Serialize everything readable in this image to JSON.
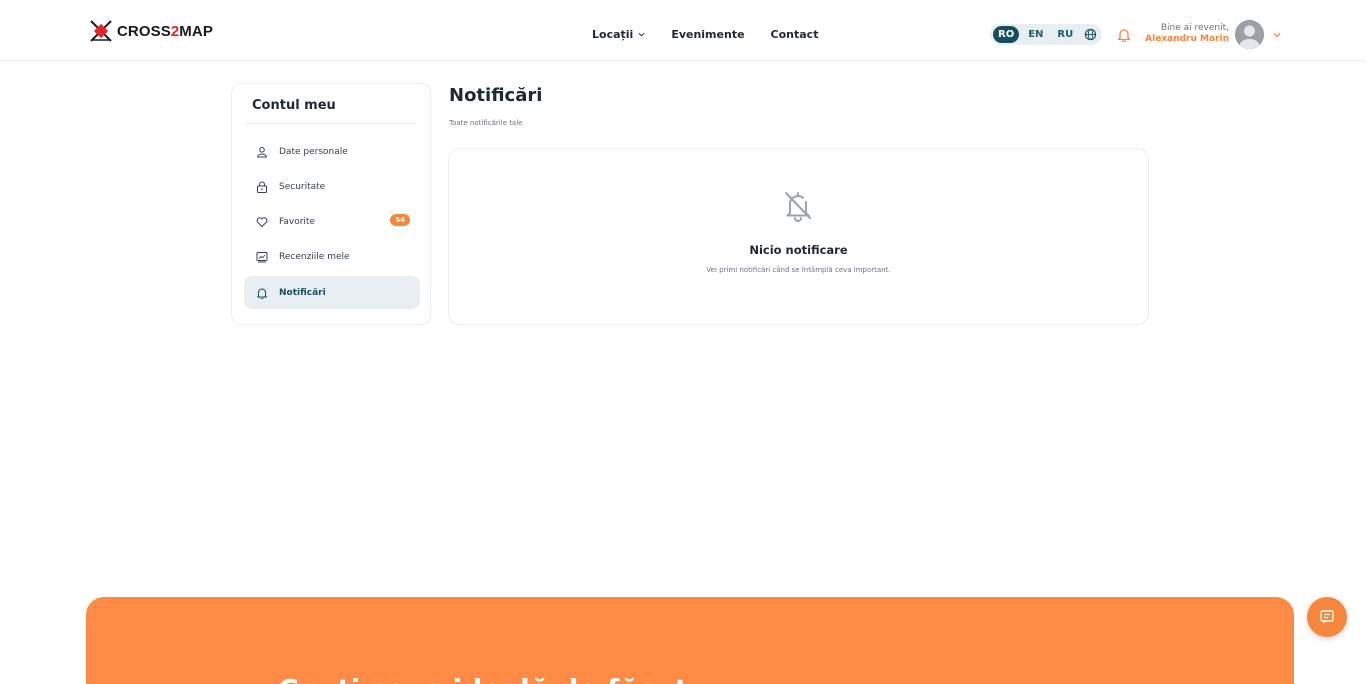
{
  "header": {
    "logo_prefix": "CROSS",
    "logo_two": "2",
    "logo_suffix": "MAP",
    "nav": [
      {
        "label": "Locații",
        "icon": "chevron-down-icon"
      },
      {
        "label": "Evenimente"
      },
      {
        "label": "Contact"
      }
    ],
    "languages": [
      "RO",
      "EN",
      "RU"
    ],
    "active_language": "RO",
    "welcome": "Bine ai revenit,",
    "user_name": "Alexandru Marin"
  },
  "sidebar": {
    "title": "Contul meu",
    "items": [
      {
        "label": "Date personale",
        "icon": "user-icon"
      },
      {
        "label": "Securitate",
        "icon": "lock-icon"
      },
      {
        "label": "Favorite",
        "icon": "heart-icon",
        "badge": "54"
      },
      {
        "label": "Recenziile mele",
        "icon": "review-icon"
      },
      {
        "label": "Notificări",
        "icon": "bell-icon",
        "active": true
      }
    ]
  },
  "main": {
    "title": "Notificări",
    "subtitle": "Toate notificările tale",
    "empty_title": "Nicio notificare",
    "empty_text": "Vei primi notificări când se întâmplă ceva important."
  },
  "banner": {
    "text": "Cauți ceva ideală de făcut"
  },
  "colors": {
    "accent": "#f5863b",
    "primary": "#164e5c",
    "banner": "#ff8a45"
  }
}
